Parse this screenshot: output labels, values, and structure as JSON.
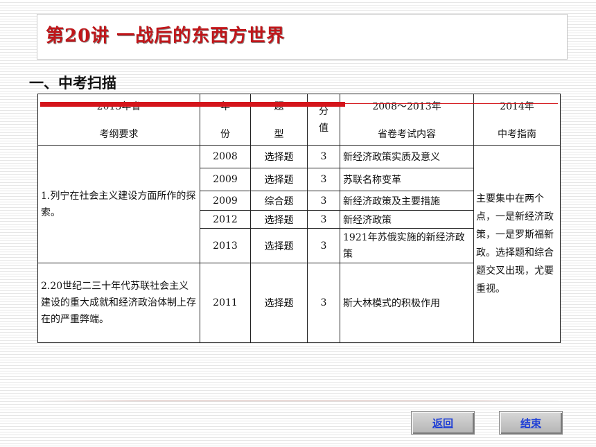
{
  "header": {
    "title": "第20讲  一战后的东西方世界"
  },
  "section": {
    "heading": "一、中考扫描"
  },
  "table": {
    "headers": {
      "requirement_top": "2013年省",
      "requirement_bottom": "考纲要求",
      "year_top": "年",
      "year_bottom": "份",
      "type_top": "题",
      "type_bottom": "型",
      "score_top": "分",
      "score_bottom": "值",
      "content_top": "2008～2013年",
      "content_bottom": "省卷考试内容",
      "guide_top": "2014年",
      "guide_bottom": "中考指南"
    },
    "requirements": [
      "1.列宁在社会主义建设方面所作的探索。",
      "2.20世纪二三十年代苏联社会主义建设的重大成就和经济政治体制上存在的严重弊端。"
    ],
    "rows": [
      {
        "year": "2008",
        "type": "选择题",
        "score": "3",
        "content": "新经济政策实质及意义"
      },
      {
        "year": "2009",
        "type": "选择题",
        "score": "3",
        "content": "苏联名称变革"
      },
      {
        "year": "2009",
        "type": "综合题",
        "score": "3",
        "content": "新经济政策及主要措施"
      },
      {
        "year": "2012",
        "type": "选择题",
        "score": "3",
        "content": "新经济政策"
      },
      {
        "year": "2013",
        "type": "选择题",
        "score": "3",
        "content": "1921年苏俄实施的新经济政策"
      },
      {
        "year": "2011",
        "type": "选择题",
        "score": "3",
        "content": "斯大林模式的积极作用"
      }
    ],
    "guide": "主要集中在两个点，一是新经济政策，一是罗斯福新政。选择题和综合题交叉出现，尤要重视。"
  },
  "nav": {
    "back_label": "返回",
    "end_label": "结束"
  },
  "colors": {
    "title": "#c0161a",
    "accent_line": "#d4151b",
    "link": "#1f3fd6"
  }
}
